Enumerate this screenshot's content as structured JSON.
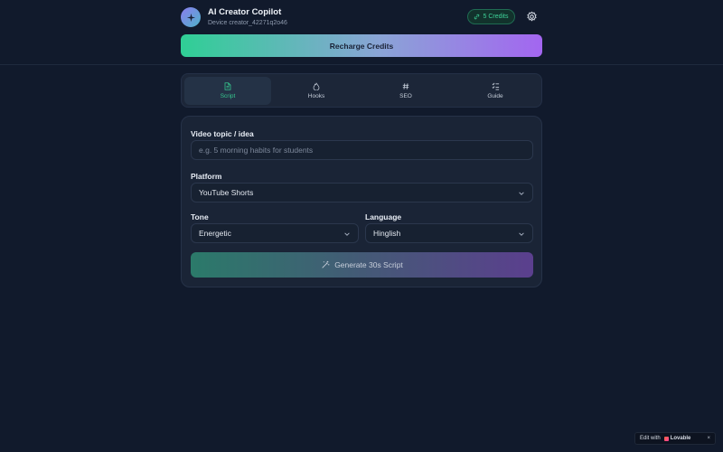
{
  "header": {
    "app_title": "AI Creator Copilot",
    "device_label": "Device creator_42271q2o46",
    "credits_label": "5 Credits",
    "recharge_label": "Recharge Credits"
  },
  "tabs": [
    {
      "label": "Script",
      "icon": "document-icon",
      "active": true
    },
    {
      "label": "Hooks",
      "icon": "flame-icon",
      "active": false
    },
    {
      "label": "SEO",
      "icon": "hash-icon",
      "active": false
    },
    {
      "label": "Guide",
      "icon": "checklist-icon",
      "active": false
    }
  ],
  "form": {
    "topic_label": "Video topic / idea",
    "topic_placeholder": "e.g. 5 morning habits for students",
    "topic_value": "",
    "platform_label": "Platform",
    "platform_value": "YouTube Shorts",
    "tone_label": "Tone",
    "tone_value": "Energetic",
    "language_label": "Language",
    "language_value": "Hinglish",
    "generate_label": "Generate 30s Script"
  },
  "badge": {
    "edit_with": "Edit with",
    "brand": "Lovable",
    "close": "×"
  },
  "colors": {
    "background": "#111a2c",
    "accent_green": "#36c88f",
    "accent_purple": "#a366f0"
  }
}
